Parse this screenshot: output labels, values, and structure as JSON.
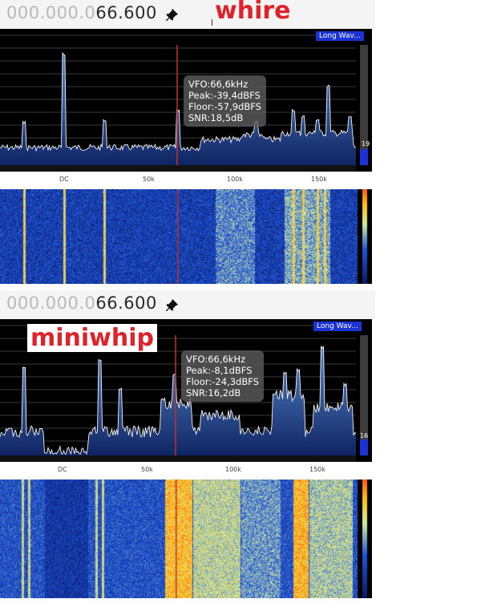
{
  "panels": [
    {
      "frequency_dim": "000.000.0",
      "frequency_bright": "66.600",
      "pin_icon": "pin-icon",
      "annotation": "whire",
      "mode_badge": "Long Wav...",
      "info": {
        "vfo": "VFO:66,6kHz",
        "peak": "Peak:-39,4dBFS",
        "floor": "Floor:-57,9dBFS",
        "snr": "SNR:18,5dB"
      },
      "axis_ticks": [
        "DC",
        "50k",
        "100k",
        "150k"
      ],
      "scale_value": "19"
    },
    {
      "frequency_dim": "000.000.0",
      "frequency_bright": "66.600",
      "pin_icon": "pin-icon",
      "annotation": "miniwhip",
      "mode_badge": "Long Wav...",
      "info": {
        "vfo": "VFO:66,6kHz",
        "peak": "Peak:-8,1dBFS",
        "floor": "Floor:-24,3dBFS",
        "snr": "SNR:16,2dB"
      },
      "axis_ticks": [
        "DC",
        "50k",
        "100k",
        "150k"
      ],
      "scale_value": "16"
    }
  ],
  "colors": {
    "vfo_line": "#c0322a",
    "badge": "#1b33d6",
    "annotation": "#e0222a",
    "waterfall_base": "#0a1a6a"
  }
}
